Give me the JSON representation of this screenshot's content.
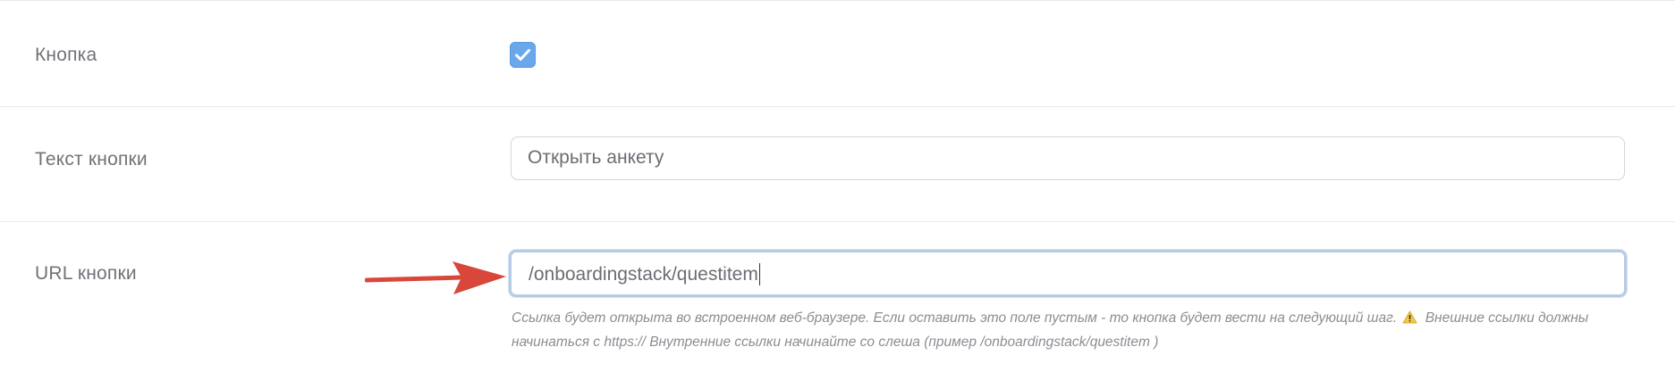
{
  "rows": [
    {
      "label": "Кнопка",
      "control": "checkbox",
      "checked": true
    },
    {
      "label": "Текст кнопки",
      "control": "input",
      "value": "Открыть анкету"
    },
    {
      "label": "URL кнопки",
      "control": "input",
      "value": "/onboardingstack/questitem",
      "focused": true,
      "hint_part1": "Ссылка будет открыта во встроенном веб-браузере. Если оставить это поле пустым - то кнопка будет вести на следующий шаг.",
      "hint_part2": "Внешние ссылки должны начинаться с https:// Внутренние ссылки начинайте со слеша (пример /onboardingstack/questitem )"
    }
  ],
  "colors": {
    "checkbox": "#6aa8ec",
    "focus_border": "#b7cce4",
    "arrow": "#d9473b",
    "warning": "#f2c94c"
  },
  "icons": {
    "checkbox": "check-icon",
    "hint_warning": "warning-icon",
    "annotation": "red-arrow-icon"
  }
}
